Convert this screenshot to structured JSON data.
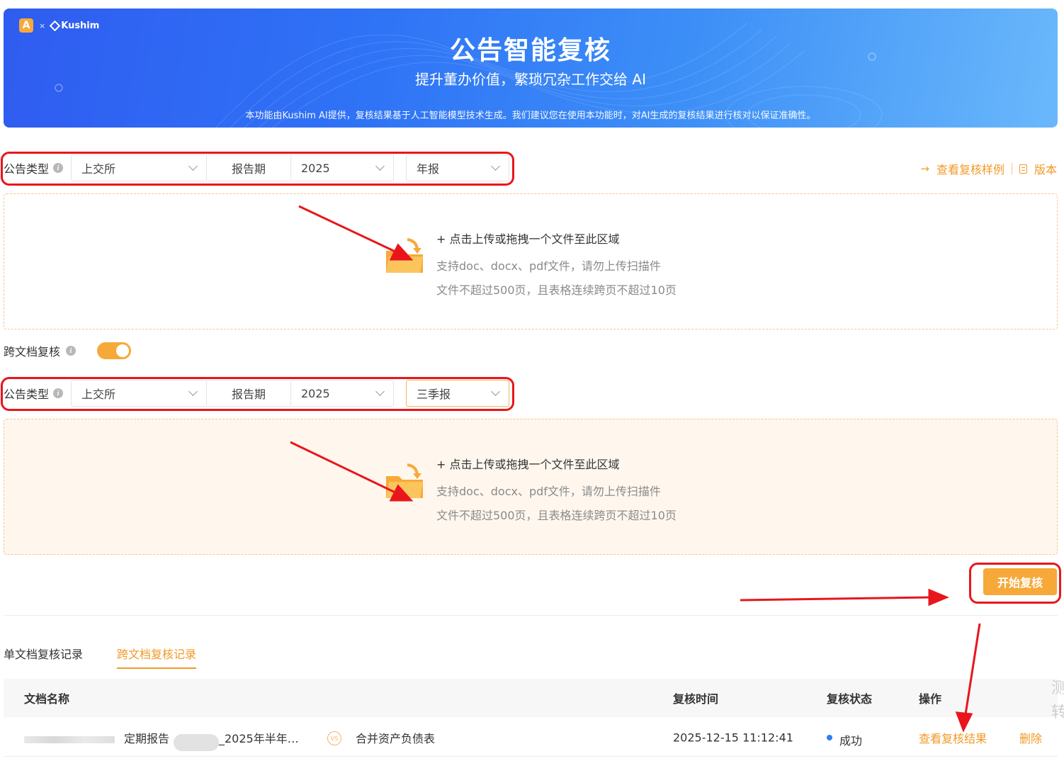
{
  "banner": {
    "brand_letter": "A",
    "brand_x": "×",
    "brand_name": "Kushim",
    "title": "公告智能复核",
    "subtitle": "提升董办价值，繁琐冗杂工作交给 AI",
    "note": "本功能由Kushim AI提供，复核结果基于人工智能模型技术生成。我们建议您在使用本功能时，对AI生成的复核结果进行核对以保证准确性。"
  },
  "links": {
    "view_example": "查看复核样例",
    "version": "版本"
  },
  "filter1": {
    "type_label": "公告类型",
    "exchange": "上交所",
    "period_label": "报告期",
    "year": "2025",
    "report": "年报"
  },
  "upload": {
    "main": "+ 点击上传或拖拽一个文件至此区域",
    "sub1": "支持doc、docx、pdf文件，请勿上传扫描件",
    "sub2": "文件不超过500页，且表格连续跨页不超过10页"
  },
  "cross": {
    "label": "跨文档复核",
    "enabled": true
  },
  "filter2": {
    "type_label": "公告类型",
    "exchange": "上交所",
    "period_label": "报告期",
    "year": "2025",
    "report": "三季报"
  },
  "start_button": "开始复核",
  "tabs": [
    {
      "label": "单文档复核记录",
      "active": false
    },
    {
      "label": "跨文档复核记录",
      "active": true
    }
  ],
  "table": {
    "headers": {
      "name": "文档名称",
      "time": "复核时间",
      "status": "复核状态",
      "action": "操作"
    },
    "rows": [
      {
        "doc_a_prefix": "定期报告",
        "doc_a_suffix": "_2025年半年…",
        "doc_b": "合并资产负债表",
        "vs": "VS",
        "time": "2025-12-15 11:12:41",
        "status": "成功",
        "view": "查看复核结果",
        "delete": "删除"
      }
    ]
  },
  "side_text": "测转",
  "colors": {
    "accent": "#f19a27",
    "annotation_red": "#e8161c",
    "success_dot": "#2f80ed"
  }
}
